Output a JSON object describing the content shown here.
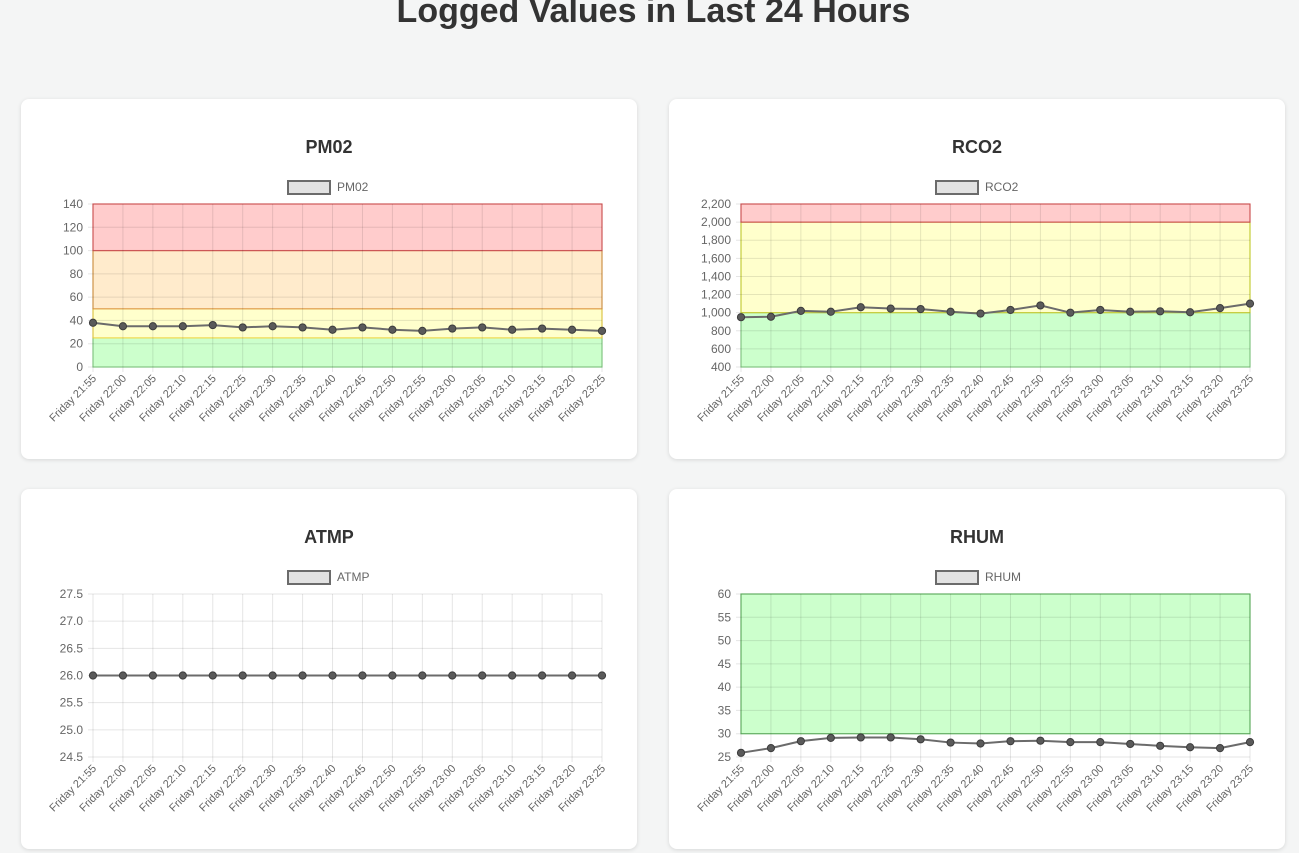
{
  "page": {
    "title": "Logged Values in Last 24 Hours"
  },
  "colors": {
    "line": "#6b6b6b",
    "point": "#5a5a5a",
    "grid": "#e6e6e6",
    "legend_fill": "#e2e2e2",
    "zone_red": "#ffcccc",
    "zone_red_line": "#e06060",
    "zone_orange": "#ffebcc",
    "zone_yellow": "#ffffcc",
    "zone_yellow_line": "#f0e050",
    "zone_green": "#ccffcc",
    "zone_green_line": "#88cc88"
  },
  "chart_data": [
    {
      "type": "line",
      "title": "PM02",
      "legend": "PM02",
      "categories": [
        "Friday 21:55",
        "Friday 22:00",
        "Friday 22:05",
        "Friday 22:10",
        "Friday 22:15",
        "Friday 22:25",
        "Friday 22:30",
        "Friday 22:35",
        "Friday 22:40",
        "Friday 22:45",
        "Friday 22:50",
        "Friday 22:55",
        "Friday 23:00",
        "Friday 23:05",
        "Friday 23:10",
        "Friday 23:15",
        "Friday 23:20",
        "Friday 23:25"
      ],
      "values": [
        38,
        35,
        35,
        35,
        36,
        34,
        35,
        34,
        32,
        34,
        32,
        31,
        33,
        34,
        32,
        33,
        32,
        31
      ],
      "ylim": [
        0,
        140
      ],
      "yticks": [
        0,
        20,
        40,
        60,
        80,
        100,
        120,
        140
      ],
      "bands": [
        {
          "from": 0,
          "to": 25,
          "fill": "#ccffcc",
          "stroke": "#8fd68f"
        },
        {
          "from": 25,
          "to": 50,
          "fill": "#ffffcc",
          "stroke": "#f0d850"
        },
        {
          "from": 50,
          "to": 100,
          "fill": "#ffebcc",
          "stroke": "#e0a050"
        },
        {
          "from": 100,
          "to": 140,
          "fill": "#ffcccc",
          "stroke": "#e06060"
        }
      ]
    },
    {
      "type": "line",
      "title": "RCO2",
      "legend": "RCO2",
      "categories": [
        "Friday 21:55",
        "Friday 22:00",
        "Friday 22:05",
        "Friday 22:10",
        "Friday 22:15",
        "Friday 22:25",
        "Friday 22:30",
        "Friday 22:35",
        "Friday 22:40",
        "Friday 22:45",
        "Friday 22:50",
        "Friday 22:55",
        "Friday 23:00",
        "Friday 23:05",
        "Friday 23:10",
        "Friday 23:15",
        "Friday 23:20",
        "Friday 23:25"
      ],
      "values": [
        950,
        955,
        1020,
        1010,
        1060,
        1045,
        1040,
        1010,
        990,
        1030,
        1080,
        1000,
        1030,
        1010,
        1015,
        1005,
        1050,
        1100
      ],
      "ylim": [
        400,
        2200
      ],
      "yticks": [
        400,
        600,
        800,
        1000,
        1200,
        1400,
        1600,
        1800,
        2000,
        2200
      ],
      "bands": [
        {
          "from": 400,
          "to": 1000,
          "fill": "#ccffcc",
          "stroke": "#8fd68f"
        },
        {
          "from": 1000,
          "to": 2000,
          "fill": "#ffffcc",
          "stroke": "#d8e040"
        },
        {
          "from": 2000,
          "to": 2200,
          "fill": "#ffcccc",
          "stroke": "#e06060"
        }
      ]
    },
    {
      "type": "line",
      "title": "ATMP",
      "legend": "ATMP",
      "categories": [
        "Friday 21:55",
        "Friday 22:00",
        "Friday 22:05",
        "Friday 22:10",
        "Friday 22:15",
        "Friday 22:25",
        "Friday 22:30",
        "Friday 22:35",
        "Friday 22:40",
        "Friday 22:45",
        "Friday 22:50",
        "Friday 22:55",
        "Friday 23:00",
        "Friday 23:05",
        "Friday 23:10",
        "Friday 23:15",
        "Friday 23:20",
        "Friday 23:25"
      ],
      "values": [
        26.0,
        26.0,
        26.0,
        26.0,
        26.0,
        26.0,
        26.0,
        26.0,
        26.0,
        26.0,
        26.0,
        26.0,
        26.0,
        26.0,
        26.0,
        26.0,
        26.0,
        26.0
      ],
      "ylim": [
        24.5,
        27.5
      ],
      "yticks": [
        24.5,
        25.0,
        25.5,
        26.0,
        26.5,
        27.0,
        27.5
      ],
      "bands": []
    },
    {
      "type": "line",
      "title": "RHUM",
      "legend": "RHUM",
      "categories": [
        "Friday 21:55",
        "Friday 22:00",
        "Friday 22:05",
        "Friday 22:10",
        "Friday 22:15",
        "Friday 22:25",
        "Friday 22:30",
        "Friday 22:35",
        "Friday 22:40",
        "Friday 22:45",
        "Friday 22:50",
        "Friday 22:55",
        "Friday 23:00",
        "Friday 23:05",
        "Friday 23:10",
        "Friday 23:15",
        "Friday 23:20",
        "Friday 23:25"
      ],
      "values": [
        25.9,
        26.9,
        28.4,
        29.1,
        29.2,
        29.2,
        28.8,
        28.1,
        27.9,
        28.4,
        28.5,
        28.2,
        28.2,
        27.8,
        27.4,
        27.1,
        26.9,
        28.2
      ],
      "ylim": [
        25,
        60
      ],
      "yticks": [
        25,
        30,
        35,
        40,
        45,
        50,
        55,
        60
      ],
      "bands": [
        {
          "from": 30,
          "to": 60,
          "fill": "#ccffcc",
          "stroke": "#6cbf6c"
        }
      ]
    }
  ]
}
